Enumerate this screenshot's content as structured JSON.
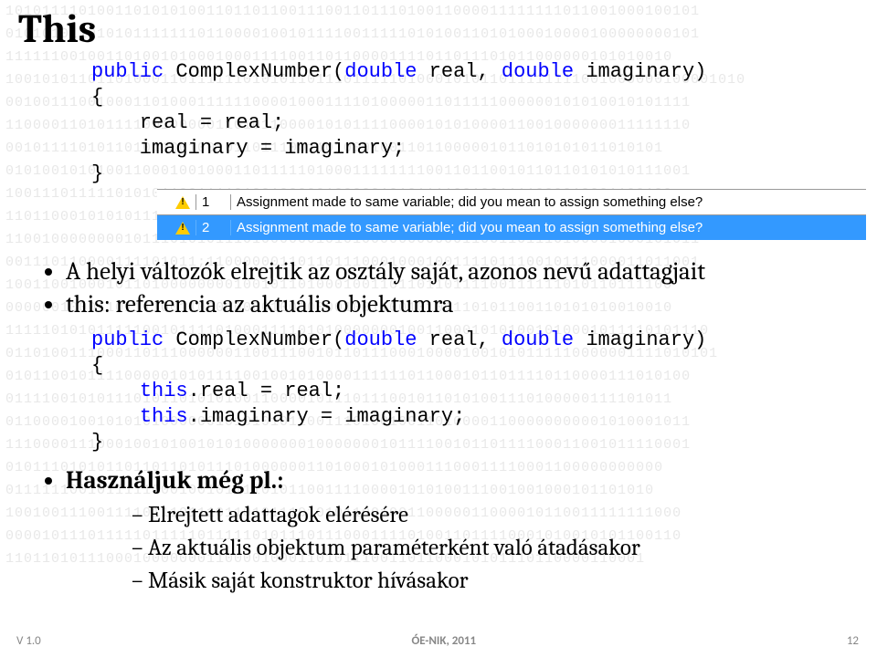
{
  "title": "This",
  "code1": {
    "l1a": "public",
    "l1b": " ComplexNumber(",
    "l1c": "double",
    "l1d": " real, ",
    "l1e": "double",
    "l1f": " imaginary)",
    "l2": "{",
    "l3": "    real = real;",
    "l4": "    imaginary = imaginary;",
    "l5": "}"
  },
  "warn1": {
    "num": "1",
    "msg": "Assignment made to same variable; did you mean to assign something else?"
  },
  "warn2": {
    "num": "2",
    "msg": "Assignment made to same variable; did you mean to assign something else?"
  },
  "bul1": "A helyi változók elrejtik az osztály saját, azonos nevű adattagjait",
  "bul2": "this: referencia az aktuális objektumra",
  "code2": {
    "l1a": "public",
    "l1b": " ComplexNumber(",
    "l1c": "double",
    "l1d": " real, ",
    "l1e": "double",
    "l1f": " imaginary)",
    "l2": "{",
    "l3a": "    ",
    "l3b": "this",
    "l3c": ".real = real;",
    "l4a": "    ",
    "l4b": "this",
    "l4c": ".imaginary = imaginary;",
    "l5": "}"
  },
  "bul3": "Használjuk még pl.:",
  "sub1": "Elrejtett adattagok elérésére",
  "sub2": "Az aktuális objektum paraméterként való átadásakor",
  "sub3": "Másik saját konstruktor hívásakor",
  "footer": {
    "left": "V 1.0",
    "mid": "ÓE-NIK, 2011",
    "right": "12"
  },
  "binary": "1010111101001101010100110110110011100110111010011000011111111011001000100101\n0101010110101011111110110000100101111001111101010011010100010000100000000101\n1111110010011010010100010001111001101100001111011011101011000000101010010\n100101011011010001101111110101011011101111101000101011011111111001000000100001010\n001001110010001101000111111000010001111010000011011111000000101010010101111\n110000110101111001000001101011000010101111000010101000011001000000011111110\n001011110101101011001001011011100110100010011011000001011010101011010101\n010100101010011000100100011011111010001111111100110110010110110101010111001\n1001110111110101011001111010010000010000010101111001001111000010001100100\n110110001010101110000010100001110111001011101101111100010111110110001111101\n1100100000000101110101011101000000101010000000000011001101110100001000101011\n001110110000111101011;110000001101101110001000100111101110010111000011011001\n1001100100010110100000000100101101000100110110110111100111111010110111100\n0000001000110111100110001000010010000100110010101110101100110101010010010\n11111010101111100101111010001111010100000001001100010101001010001011110101110\n011010011100011011100000011001110010110111000100001001010111110000001111010101\n010110010111100000101011110010010100001111110110001011011110110000111010100\n0111100101011101011010101001100001011101110010110101001110100000111101011\n011000010010101010000001010101011001110100100110100001100000000001010001011\n111000011100010010100101010000000100000001011110010110111100011001011110001\n010111010101101101101011101000000110100010100011100011110001100000000000\n01111110010111110001001011110101100111100001010100111001001000101101010\n10010011100111101110111011010111010101100100110000011000010110011111111000\n00001011101111101111101111101011101110001111010011011110001010010101100110\n1101101011100010000000110000100011010111001101100010101110110000110001"
}
